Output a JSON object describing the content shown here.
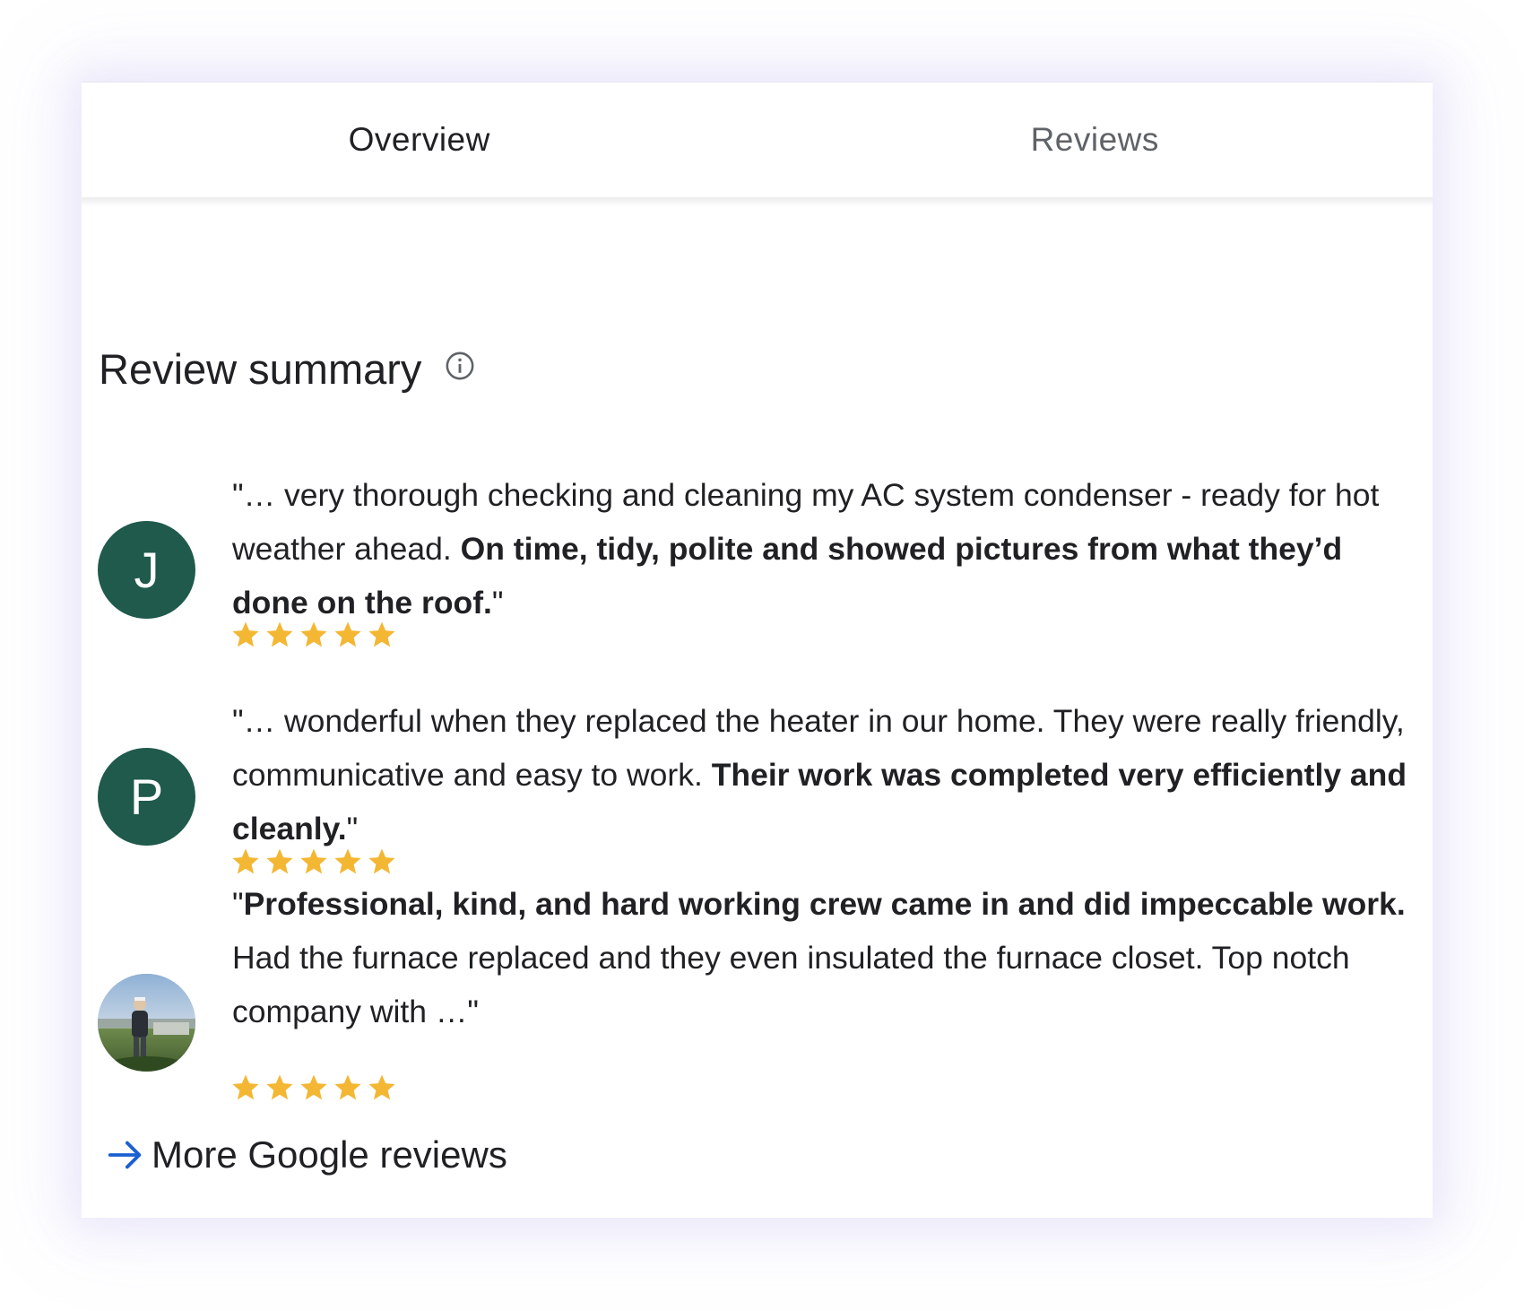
{
  "tabs": [
    {
      "label": "Overview",
      "active": true
    },
    {
      "label": "Reviews",
      "active": false
    }
  ],
  "summary": {
    "title": "Review summary",
    "info_icon": "info-icon"
  },
  "reviews": [
    {
      "avatar_letter": "J",
      "avatar_color": "#1f5a4c",
      "text_plain": "\"… very thorough checking and cleaning my AC system condenser - ready for hot weather ahead. ",
      "text_bold": "On time, tidy, polite and showed pictures from what they’d done on the roof.",
      "text_end": "\"",
      "rating": 5
    },
    {
      "avatar_letter": "P",
      "avatar_color": "#1f5a4c",
      "text_plain": "\"… wonderful when they replaced the heater in our home. They were really friendly, communicative and easy to work. ",
      "text_bold": "Their work was completed very efficiently and cleanly.",
      "text_end": "\"",
      "rating": 5
    },
    {
      "avatar_letter": "",
      "avatar_photo": "person-outdoors-photo",
      "text_start": "\"",
      "text_bold": "Professional, kind, and hard working crew came in and did impeccable work.",
      "text_plain": " Had the furnace replaced and they even insulated the furnace closet. Top notch company with …\"",
      "rating": 5
    }
  ],
  "more_link": {
    "label": "More Google reviews",
    "icon": "arrow-right-icon"
  },
  "colors": {
    "accent": "#1a5fd0",
    "star": "#f4b733",
    "text": "#202124",
    "muted": "#5f6368"
  }
}
